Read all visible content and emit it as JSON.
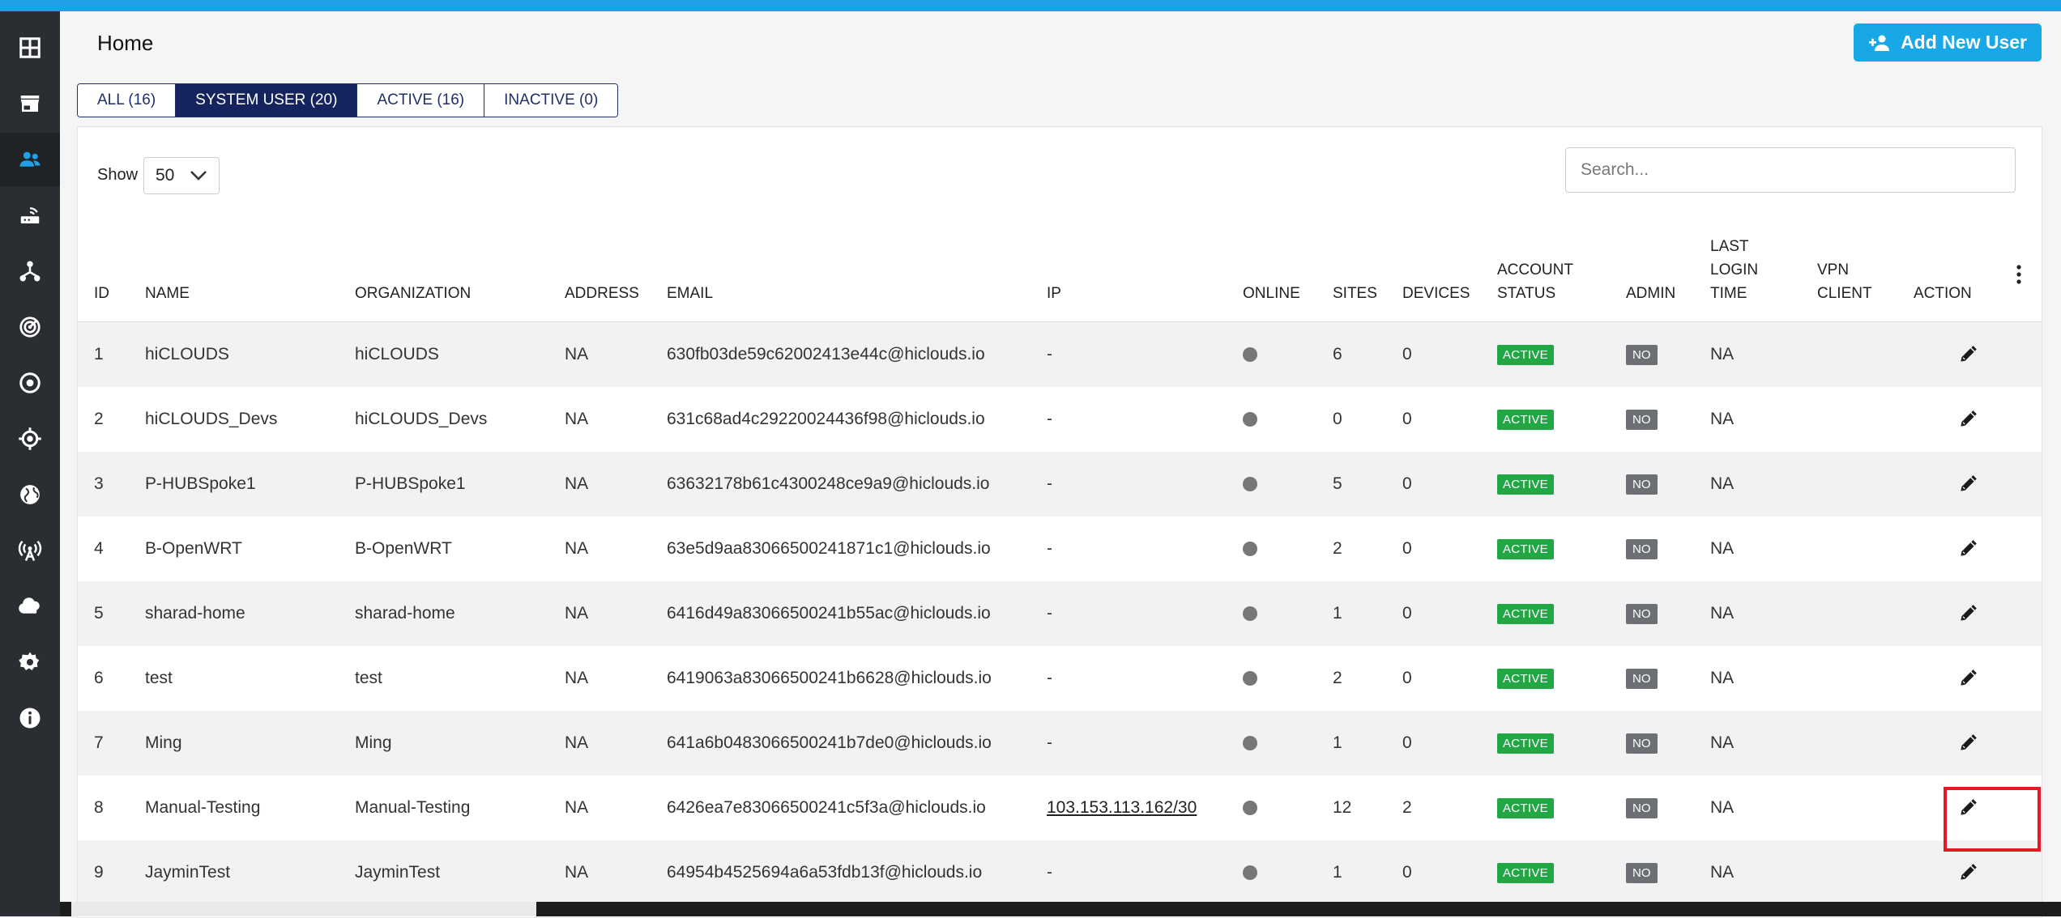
{
  "window": {
    "accent": "#1ea1e6"
  },
  "sidebar": {
    "items": [
      {
        "icon": "dashboard-grid-icon"
      },
      {
        "icon": "store-icon"
      },
      {
        "icon": "users-icon",
        "active": true
      },
      {
        "icon": "router-icon"
      },
      {
        "icon": "network-topology-icon"
      },
      {
        "icon": "radar-icon"
      },
      {
        "icon": "target-circle-icon"
      },
      {
        "icon": "crosshair-location-icon"
      },
      {
        "icon": "globe-icon"
      },
      {
        "icon": "wireless-tower-icon"
      },
      {
        "icon": "cloud-icon"
      },
      {
        "icon": "gear-icon"
      },
      {
        "icon": "info-icon"
      }
    ]
  },
  "header": {
    "title": "Home",
    "add_button_label": "Add New User"
  },
  "tabs": [
    {
      "label": "ALL (16)",
      "active": false
    },
    {
      "label": "SYSTEM USER (20)",
      "active": true
    },
    {
      "label": "ACTIVE (16)",
      "active": false
    },
    {
      "label": "INACTIVE (0)",
      "active": false
    }
  ],
  "table_controls": {
    "show_label": "Show",
    "page_size": "50",
    "search_placeholder": "Search..."
  },
  "columns": {
    "id": [
      "ID"
    ],
    "name": [
      "NAME"
    ],
    "organization": [
      "ORGANIZATION"
    ],
    "address": [
      "ADDRESS"
    ],
    "email": [
      "EMAIL"
    ],
    "ip": [
      "IP"
    ],
    "online": [
      "ONLINE"
    ],
    "sites": [
      "SITES"
    ],
    "devices": [
      "DEVICES"
    ],
    "account_status": [
      "ACCOUNT",
      "STATUS"
    ],
    "admin": [
      "ADMIN"
    ],
    "last_login": [
      "LAST",
      "LOGIN",
      "TIME"
    ],
    "vpn_client": [
      "VPN",
      "CLIENT"
    ],
    "action": [
      "ACTION"
    ]
  },
  "rows": [
    {
      "id": "1",
      "name": "hiCLOUDS",
      "organization": "hiCLOUDS",
      "address": "NA",
      "email": "630fb03de59c62002413e44c@hiclouds.io",
      "ip": "-",
      "ip_link": false,
      "sites": "6",
      "devices": "0",
      "status": "ACTIVE",
      "admin": "NO",
      "last_login": "NA",
      "vpn": ""
    },
    {
      "id": "2",
      "name": "hiCLOUDS_Devs",
      "organization": "hiCLOUDS_Devs",
      "address": "NA",
      "email": "631c68ad4c29220024436f98@hiclouds.io",
      "ip": "-",
      "ip_link": false,
      "sites": "0",
      "devices": "0",
      "status": "ACTIVE",
      "admin": "NO",
      "last_login": "NA",
      "vpn": ""
    },
    {
      "id": "3",
      "name": "P-HUBSpoke1",
      "organization": "P-HUBSpoke1",
      "address": "NA",
      "email": "63632178b61c4300248ce9a9@hiclouds.io",
      "ip": "-",
      "ip_link": false,
      "sites": "5",
      "devices": "0",
      "status": "ACTIVE",
      "admin": "NO",
      "last_login": "NA",
      "vpn": ""
    },
    {
      "id": "4",
      "name": "B-OpenWRT",
      "organization": "B-OpenWRT",
      "address": "NA",
      "email": "63e5d9aa83066500241871c1@hiclouds.io",
      "ip": "-",
      "ip_link": false,
      "sites": "2",
      "devices": "0",
      "status": "ACTIVE",
      "admin": "NO",
      "last_login": "NA",
      "vpn": ""
    },
    {
      "id": "5",
      "name": "sharad-home",
      "organization": "sharad-home",
      "address": "NA",
      "email": "6416d49a83066500241b55ac@hiclouds.io",
      "ip": "-",
      "ip_link": false,
      "sites": "1",
      "devices": "0",
      "status": "ACTIVE",
      "admin": "NO",
      "last_login": "NA",
      "vpn": ""
    },
    {
      "id": "6",
      "name": "test",
      "organization": "test",
      "address": "NA",
      "email": "6419063a83066500241b6628@hiclouds.io",
      "ip": "-",
      "ip_link": false,
      "sites": "2",
      "devices": "0",
      "status": "ACTIVE",
      "admin": "NO",
      "last_login": "NA",
      "vpn": ""
    },
    {
      "id": "7",
      "name": "Ming",
      "organization": "Ming",
      "address": "NA",
      "email": "641a6b0483066500241b7de0@hiclouds.io",
      "ip": "-",
      "ip_link": false,
      "sites": "1",
      "devices": "0",
      "status": "ACTIVE",
      "admin": "NO",
      "last_login": "NA",
      "vpn": ""
    },
    {
      "id": "8",
      "name": "Manual-Testing",
      "organization": "Manual-Testing",
      "address": "NA",
      "email": "6426ea7e83066500241c5f3a@hiclouds.io",
      "ip": "103.153.113.162/30",
      "ip_link": true,
      "sites": "12",
      "devices": "2",
      "status": "ACTIVE",
      "admin": "NO",
      "last_login": "NA",
      "vpn": ""
    },
    {
      "id": "9",
      "name": "JayminTest",
      "organization": "JayminTest",
      "address": "NA",
      "email": "64954b4525694a6a53fdb13f@hiclouds.io",
      "ip": "-",
      "ip_link": false,
      "sites": "1",
      "devices": "0",
      "status": "ACTIVE",
      "admin": "NO",
      "last_login": "NA",
      "vpn": ""
    }
  ],
  "colors": {
    "status_active": "#22a745",
    "admin_no": "#6c6f74",
    "tab_active": "#15245e",
    "highlight": "#e01b24"
  }
}
